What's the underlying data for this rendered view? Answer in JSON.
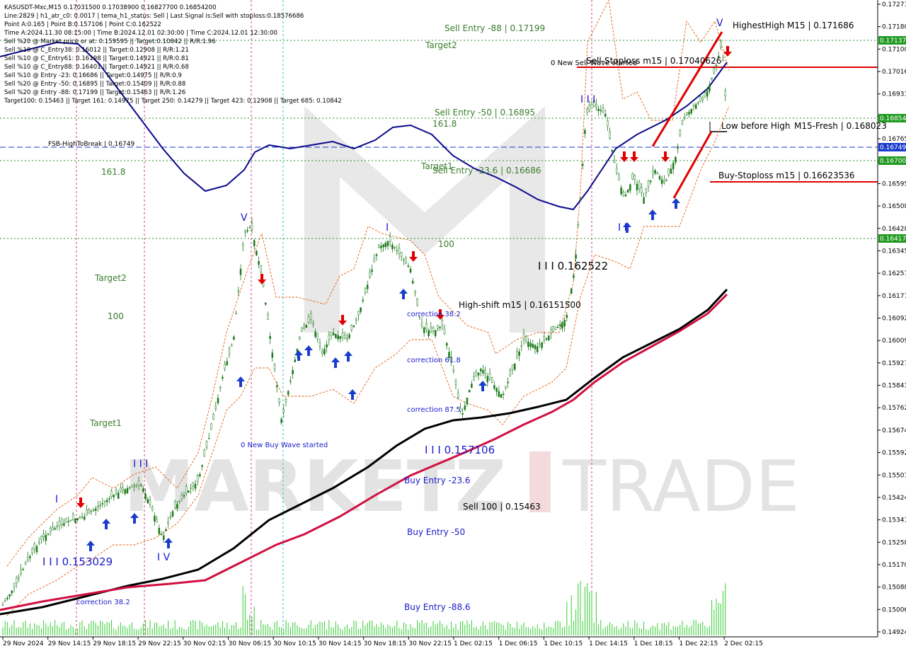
{
  "header": {
    "lines": [
      "KASUSDT-Mxc,M15  0.17031500 0.17038900 0.16827700 0.16854200",
      "Line:2829  |  h1_atr_c0: 0.0017  |  tema_h1_status: Sell  |  Last Signal is:Sell with stoploss:0.18576686",
      "Point A:0.165  |  Point B:0.157106  |  Point C:0.162522",
      "Time A:2024.11.30 08:15:00  |  Time B:2024.12.01 02:30:00  |  Time C:2024.12.01 12:30:00",
      "Sell %20 @ Market price or at: 0.159595  ||  Target:0.10842  ||  R/R:1.96",
      "Sell %10 @ C_Entry38: 0.16012  ||  Target:0.12908  ||  R/R:1.21",
      "Sell %10 @ C_Entry61: 0.16198  ||  Target:0.14921  ||  R/R:0.81",
      "Sell %10 @ C_Entry88: 0.16401  ||  Target:0.14921  ||  R/R:0.68",
      "Sell %10 @ Entry -23: 0.16686  ||  Target:0.14975  ||  R/R:0.9",
      "Sell %20 @ Entry -50: 0.16895  ||  Target:0.15409  ||  R/R:0.88",
      "Sell %20 @ Entry -88: 0.17199  ||  Target:0.15463  ||  R/R:1.26",
      "Target100: 0.15463  ||  Target 161: 0.14975  ||  Target 250: 0.14279  ||  Target 423: 0.12908  ||  Target 685: 0.10842"
    ]
  },
  "watermark": {
    "left": "MARKETZ",
    "right": "TRADE"
  },
  "colors": {
    "bg": "#ffffff",
    "green_text": "#3a7d2c",
    "blue_text": "#1a1acc",
    "red_line": "#e00000",
    "navy_ma": "#0a0a8c",
    "black_ma": "#000000",
    "crimson_ma": "#d01040",
    "candle": "#1a7a1a",
    "volume": "#33cc33",
    "dotted_green": "#2e8b2e",
    "axis_tag_green": "#1f9a1f",
    "axis_tag_blue": "#1a3ccc"
  },
  "axis": {
    "y_ticks": [
      "0.17271",
      "0.17180",
      "0.17100",
      "0.17016",
      "0.16931",
      "0.16851",
      "0.16765",
      "0.16680",
      "0.16595",
      "0.16508",
      "0.16428",
      "0.16345",
      "0.16257",
      "0.16177",
      "0.16092",
      "0.16009",
      "0.15927",
      "0.15843",
      "0.15762",
      "0.15674",
      "0.15592",
      "0.15507",
      "0.15424",
      "0.15341",
      "0.15258",
      "0.15170",
      "0.15088",
      "0.15006",
      "0.14924"
    ],
    "x_ticks": [
      "29 Nov 2024",
      "29 Nov 14:15",
      "29 Nov 18:15",
      "29 Nov 22:15",
      "30 Nov 02:15",
      "30 Nov 06:15",
      "30 Nov 10:15",
      "30 Nov 14:15",
      "30 Nov 18:15",
      "30 Nov 22:15",
      "1 Dec 02:15",
      "1 Dec 06:15",
      "1 Dec 10:15",
      "1 Dec 14:15",
      "1 Dec 18:15",
      "1 Dec 22:15",
      "2 Dec 02:15"
    ],
    "price_tags": [
      {
        "label": "0.17137",
        "kind": "green"
      },
      {
        "label": "0.16854",
        "kind": "green"
      },
      {
        "label": "0.16749",
        "kind": "blue"
      },
      {
        "label": "0.16700",
        "kind": "green"
      },
      {
        "label": "0.16417",
        "kind": "green"
      }
    ]
  },
  "annotations": {
    "sell_entry_88": "Sell Entry -88 | 0.17199",
    "target2_top": "Target2",
    "sell_stoploss": "Sell-Stoploss m15 | 0.17040626",
    "new_sell_wave": "0 New Sell Wave started",
    "highest_high_label": "HighestHigh",
    "highest_high_value": "M15 | 0.171686",
    "sell_entry_50": "Sell Entry -50 | 0.16895",
    "fib_1618_top": "161.8",
    "low_before_high_label": "Low before High",
    "low_before_high_value": "M15-Fresh | 0.168023",
    "fsb": "FSB-HighToBreak | 0.16749",
    "fib_1618_left": "161.8",
    "target1_mid": "Target1",
    "sell_entry_236": "Sell Entry -23.6 | 0.16686",
    "buy_stoploss": "Buy-Stoploss m15 | 0.16623536",
    "fib_100_mid": "100",
    "point_c": "I I I 0.162522",
    "high_shift": "High-shift m15 | 0.16151500",
    "target2_left": "Target2",
    "fib_100_left": "100",
    "correction_382_mid": "correction 38.2",
    "correction_618": "correction 61.8",
    "correction_875": "correction 87.5",
    "target1_left": "Target1",
    "new_buy_wave": "0 New Buy Wave started",
    "point_b": "I I I 0.157106",
    "buy_entry_236": "Buy Entry -23.6",
    "sell_100": "Sell 100 | 0.15463",
    "buy_entry_50": "Buy Entry -50",
    "point_a": "I I I 0.153029",
    "correction_382_low": "correction 38.2",
    "buy_entry_886": "Buy Entry -88.6",
    "wave_marks": [
      "V",
      "I",
      "V",
      "I I I",
      "I V",
      "I",
      "I I I",
      "I I"
    ]
  }
}
